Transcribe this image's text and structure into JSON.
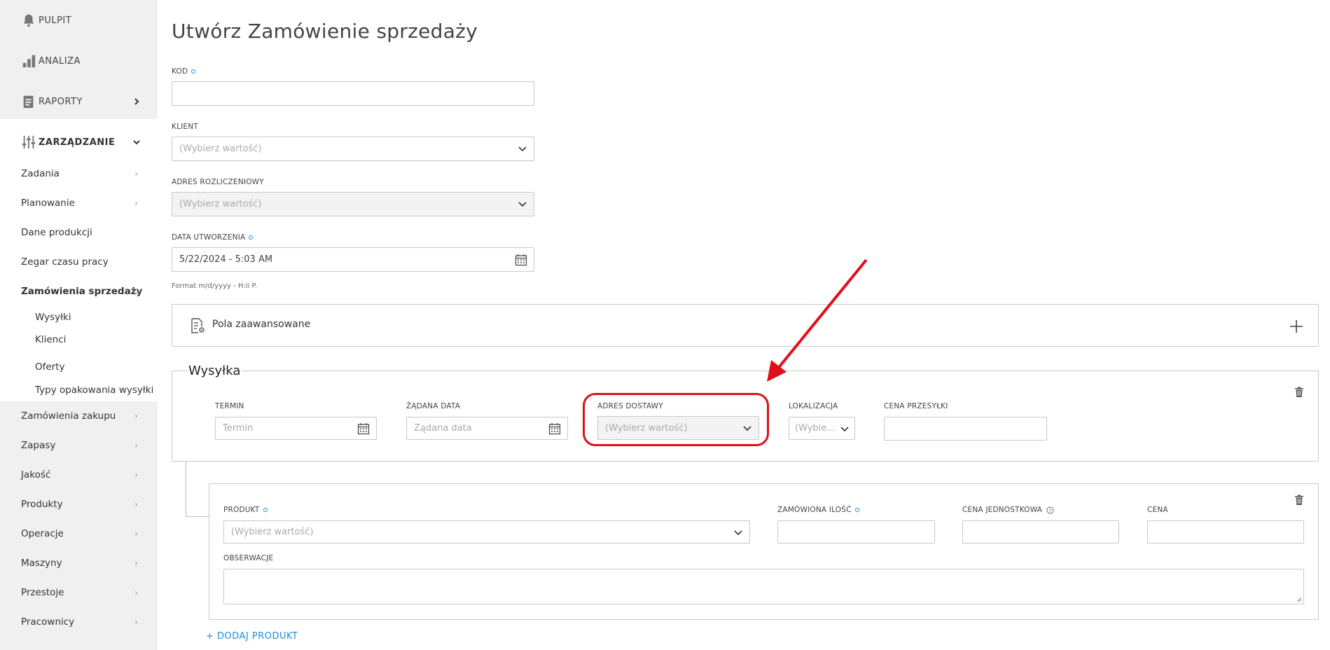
{
  "sidebar": {
    "top": [
      {
        "label": "PULPIT",
        "icon": "bell-icon"
      },
      {
        "label": "ANALIZA",
        "icon": "bar-chart-icon"
      },
      {
        "label": "RAPORTY",
        "icon": "report-icon"
      },
      {
        "label": "ZARZĄDZANIE",
        "icon": "sliders-icon"
      }
    ],
    "items": [
      "Zadania",
      "Planowanie",
      "Dane produkcji",
      "Zegar czasu pracy",
      "Zamówienia sprzedaży",
      "Zamówienia zakupu",
      "Zapasy",
      "Jakość",
      "Produkty",
      "Operacje",
      "Maszyny",
      "Przestoje",
      "Pracownicy"
    ],
    "subitems": [
      "Wysyłki",
      "Klienci",
      "Oferty",
      "Typy opakowania wysyłki"
    ]
  },
  "page": {
    "title": "Utwórz Zamówienie sprzedaży"
  },
  "form": {
    "kod_label": "KOD",
    "klient_label": "KLIENT",
    "klient_placeholder": "(Wybierz wartość)",
    "adres_label": "ADRES ROZLICZENIOWY",
    "adres_placeholder": "(Wybierz wartość)",
    "data_label": "DATA UTWORZENIA",
    "data_value": "5/22/2024 - 5:03 AM",
    "data_hint": "Format m/d/yyyy - H:ii P."
  },
  "advanced": {
    "label": "Pola zaawansowane"
  },
  "wysylka": {
    "legend": "Wysyłka",
    "termin_label": "TERMIN",
    "termin_placeholder": "Termin",
    "zadana_label": "ŻĄDANA DATA",
    "zadana_placeholder": "Żądana data",
    "adres_dostawy_label": "ADRES DOSTAWY",
    "adres_dostawy_placeholder": "(Wybierz wartość)",
    "lokalizacja_label": "LOKALIZACJA",
    "lokalizacja_placeholder": "(Wybie...",
    "cena_przesylki_label": "CENA PRZESYŁKI"
  },
  "product": {
    "produkt_label": "PRODUKT",
    "produkt_placeholder": "(Wybierz wartość)",
    "ilosc_label": "ZAMÓWIONA ILOŚĆ",
    "cena_jedn_label": "CENA JEDNOSTKOWA",
    "cena_label": "CENA",
    "obserwacje_label": "OBSERWACJE"
  },
  "add_product": "+ DODAJ PRODUKT",
  "colors": {
    "accent": "#1a8fd6",
    "annotation": "#e0101a",
    "sidebar_bg": "#f0f0f0"
  }
}
